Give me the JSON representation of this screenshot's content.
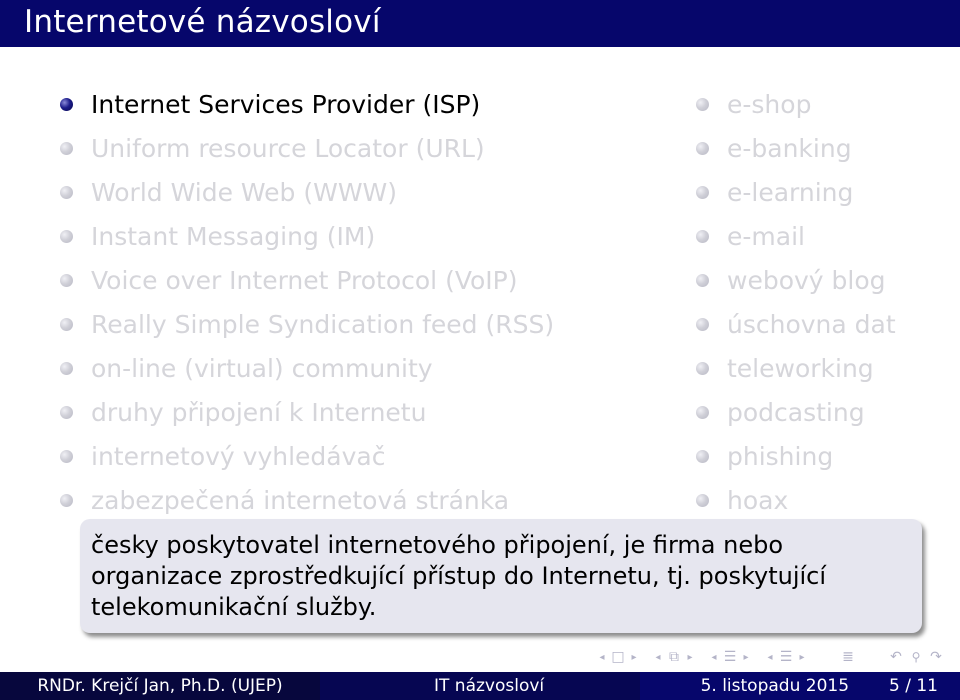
{
  "slide": {
    "title": "Internetové názvosloví",
    "left_items": [
      {
        "label": "Internet Services Provider (ISP)",
        "active": true
      },
      {
        "label": "Uniform resource Locator (URL)",
        "active": false
      },
      {
        "label": "World Wide Web (WWW)",
        "active": false
      },
      {
        "label": "Instant Messaging (IM)",
        "active": false
      },
      {
        "label": "Voice over Internet Protocol (VoIP)",
        "active": false
      },
      {
        "label": "Really Simple Syndication feed (RSS)",
        "active": false
      },
      {
        "label": "on-line (virtual) community",
        "active": false
      },
      {
        "label": "druhy připojení k Internetu",
        "active": false
      },
      {
        "label": "internetový vyhledávač",
        "active": false
      },
      {
        "label": "zabezpečená internetová stránka",
        "active": false
      }
    ],
    "right_items": [
      {
        "label": "e-shop",
        "active": false
      },
      {
        "label": "e-banking",
        "active": false
      },
      {
        "label": "e-learning",
        "active": false
      },
      {
        "label": "e-mail",
        "active": false
      },
      {
        "label": "webový blog",
        "active": false
      },
      {
        "label": "úschovna dat",
        "active": false
      },
      {
        "label": "teleworking",
        "active": false
      },
      {
        "label": "podcasting",
        "active": false
      },
      {
        "label": "phishing",
        "active": false
      },
      {
        "label": "hoax",
        "active": false
      }
    ],
    "definition": "česky poskytovatel internetového připojení, je firma nebo organizace zprostředkující přístup do Internetu, tj. poskytující telekomunikační služby."
  },
  "navigation": {
    "prev_arrow": "◂",
    "next_arrow": "▸",
    "frame_icon": "□",
    "subsection_icon": "⧉",
    "section_icon": "☰",
    "doc_icon": "≣",
    "undo_icon": "↶",
    "search_icon": "🔍︎",
    "redo_icon": "↷"
  },
  "footer": {
    "author": "RNDr. Krejčí Jan, Ph.D.  (UJEP)",
    "short_title": "IT názvosloví",
    "date": "5. listopadu 2015",
    "page": "5 / 11"
  },
  "colors": {
    "title_bg": "#06066b",
    "inactive_text": "#d5d5da",
    "box_bg": "#e6e6ef"
  }
}
